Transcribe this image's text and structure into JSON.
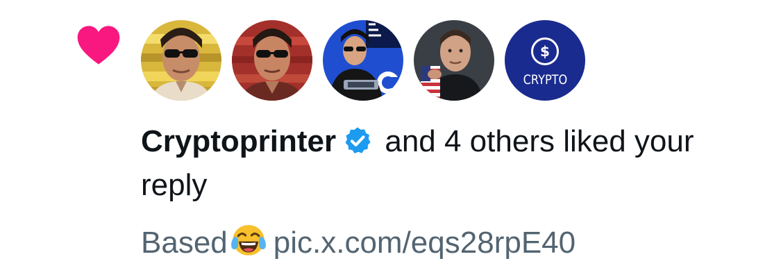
{
  "notification": {
    "type": "like",
    "heart_color": "#f91880",
    "avatars": [
      {
        "name": "avatar-1",
        "icon": "man-sunglasses-portrait"
      },
      {
        "name": "avatar-2",
        "icon": "man-sunglasses-red-portrait"
      },
      {
        "name": "avatar-3",
        "icon": "man-stage-portrait"
      },
      {
        "name": "avatar-4",
        "icon": "man-flag-portrait"
      },
      {
        "name": "avatar-5",
        "icon": "crypto-logo",
        "logo_symbol": "$",
        "logo_text": "CRYPTO"
      }
    ],
    "username": "Cryptoprinter",
    "verified": true,
    "verified_color": "#1d9bf0",
    "action_text": " and 4 others liked your reply",
    "snippet": {
      "text": "Based",
      "emoji": "face-with-tears-of-joy",
      "link": "pic.x.com/eqs28rpE40"
    }
  }
}
